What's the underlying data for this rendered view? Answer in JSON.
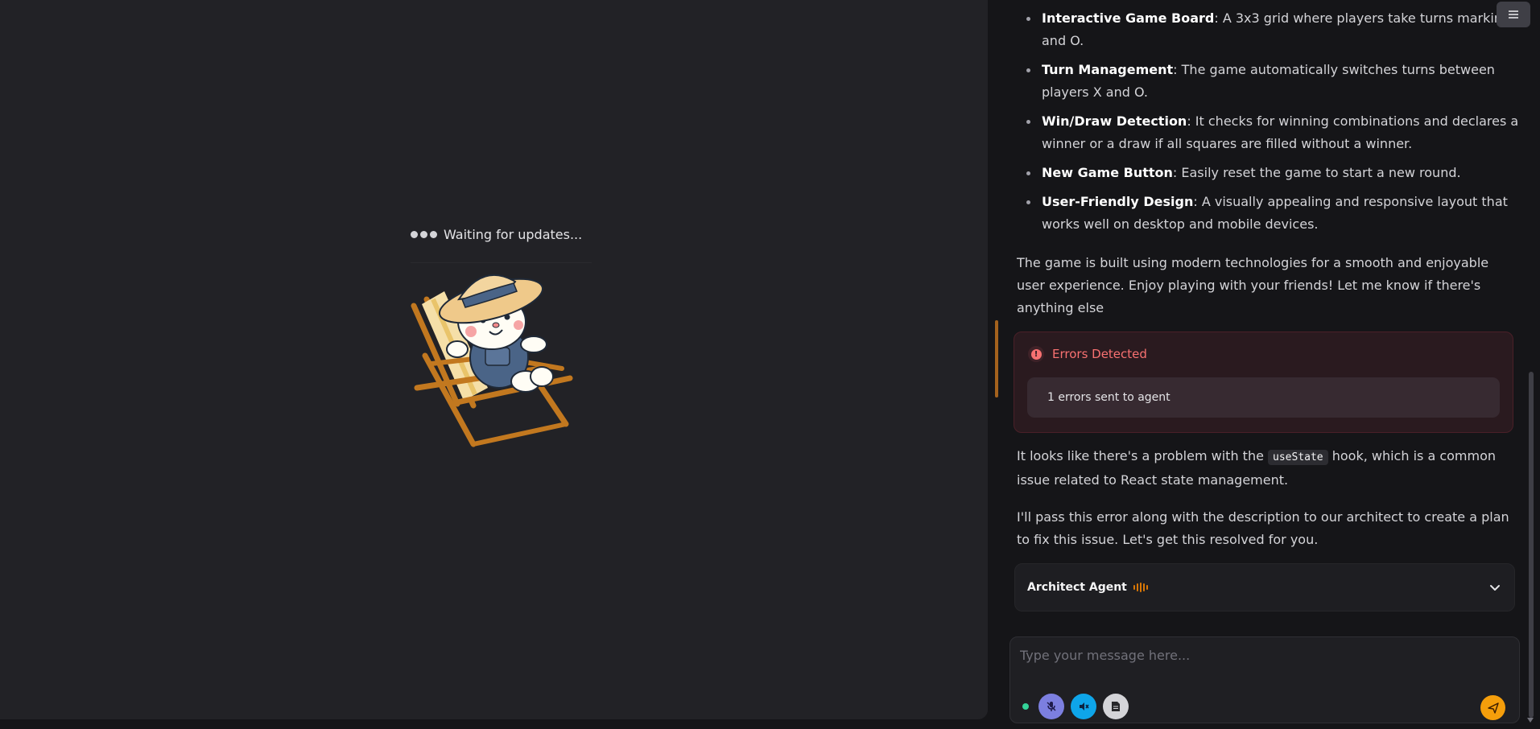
{
  "preview": {
    "waiting_text": "Waiting for updates..."
  },
  "features": [
    {
      "title": "Interactive Game Board",
      "desc": ": A 3x3 grid where players take turns marking X and O."
    },
    {
      "title": "Turn Management",
      "desc": ": The game automatically switches turns between players X and O."
    },
    {
      "title": "Win/Draw Detection",
      "desc": ": It checks for winning combinations and declares a winner or a draw if all squares are filled without a winner."
    },
    {
      "title": "New Game Button",
      "desc": ": Easily reset the game to start a new round."
    },
    {
      "title": "User-Friendly Design",
      "desc": ": A visually appealing and responsive layout that works well on desktop and mobile devices."
    }
  ],
  "messages": {
    "summary": "The game is built using modern technologies for a smooth and enjoyable user experience. Enjoy playing with your friends! Let me know if there's anything else",
    "problem_before": "It looks like there's a problem with the ",
    "problem_code": "useState",
    "problem_after": " hook, which is a common issue related to React state management.",
    "handoff": "I'll pass this error along with the description to our architect to create a plan to fix this issue. Let's get this resolved for you."
  },
  "error_box": {
    "title": "Errors Detected",
    "detail": "1 errors sent to agent",
    "color": "#f87171"
  },
  "agent": {
    "label": "Architect Agent"
  },
  "composer": {
    "placeholder": "Type your message here...",
    "value": ""
  },
  "colors": {
    "accent": "#f59e0b",
    "status": "#34d399"
  },
  "icons": {
    "menu": "hamburger-icon",
    "mic": "mic-off-icon",
    "speaker": "speaker-muted-icon",
    "doc": "document-icon",
    "send": "send-icon",
    "chevron": "chevron-down-icon",
    "error": "alert-circle-icon"
  }
}
